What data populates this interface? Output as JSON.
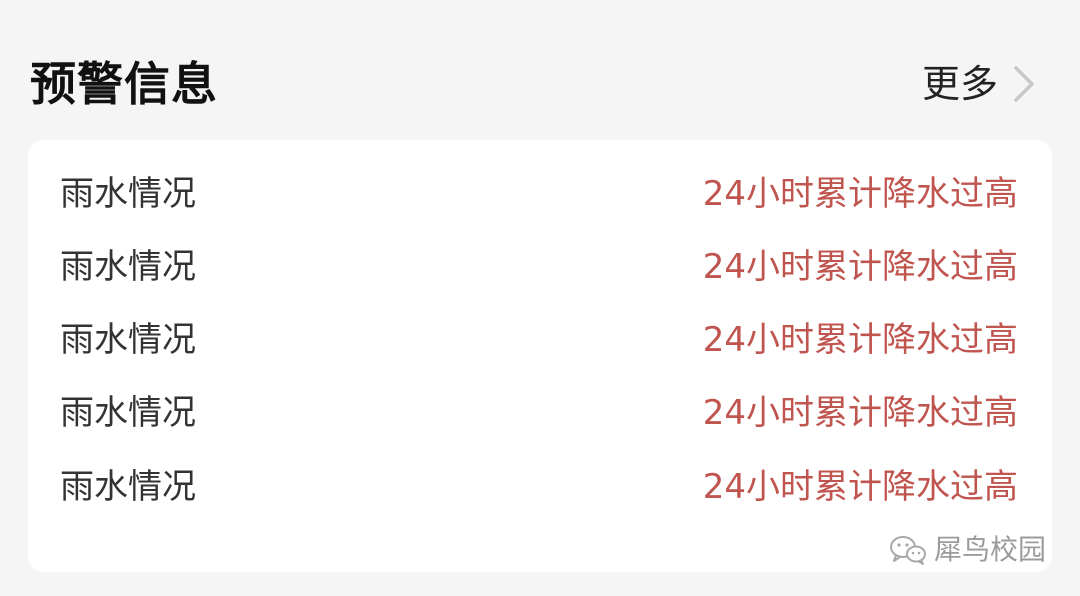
{
  "header": {
    "title": "预警信息",
    "more_label": "更多"
  },
  "alerts": [
    {
      "label": "雨水情况",
      "value": "24小时累计降水过高"
    },
    {
      "label": "雨水情况",
      "value": "24小时累计降水过高"
    },
    {
      "label": "雨水情况",
      "value": "24小时累计降水过高"
    },
    {
      "label": "雨水情况",
      "value": "24小时累计降水过高"
    },
    {
      "label": "雨水情况",
      "value": "24小时累计降水过高"
    }
  ],
  "watermark": {
    "text": "犀鸟校园",
    "icon": "wechat-icon"
  },
  "colors": {
    "background": "#f5f5f5",
    "card": "#ffffff",
    "title": "#111111",
    "alert_value": "#c0554f",
    "label": "#333333",
    "chevron": "#c8c8c8"
  }
}
